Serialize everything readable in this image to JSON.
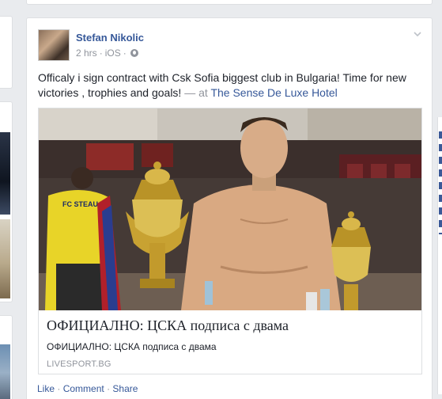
{
  "post": {
    "author": "Stefan Nikolic",
    "time": "2 hrs",
    "separator": "·",
    "platform": "iOS",
    "privacy_icon": "globe-icon",
    "menu_icon": "chevron-down-icon",
    "text": "Officaly i sign contract with Csk Sofia biggest club in Bulgaria! Time for new victories , trophies and goals!",
    "at_text": "— at",
    "place": "The Sense De Luxe Hotel"
  },
  "link_preview": {
    "title": "ОФИЦИАЛНО: ЦСКА подписа с двама",
    "description": "ОФИЦИАЛНО: ЦСКА подписа с двама",
    "domain": "LIVESPORT.BG",
    "shirt_text": "FC STEAUA"
  },
  "actions": {
    "like": "Like",
    "comment": "Comment",
    "share": "Share",
    "separator": "·"
  },
  "colors": {
    "link_blue": "#365899",
    "meta_gray": "#90949c",
    "page_bg": "#e9ebee"
  }
}
